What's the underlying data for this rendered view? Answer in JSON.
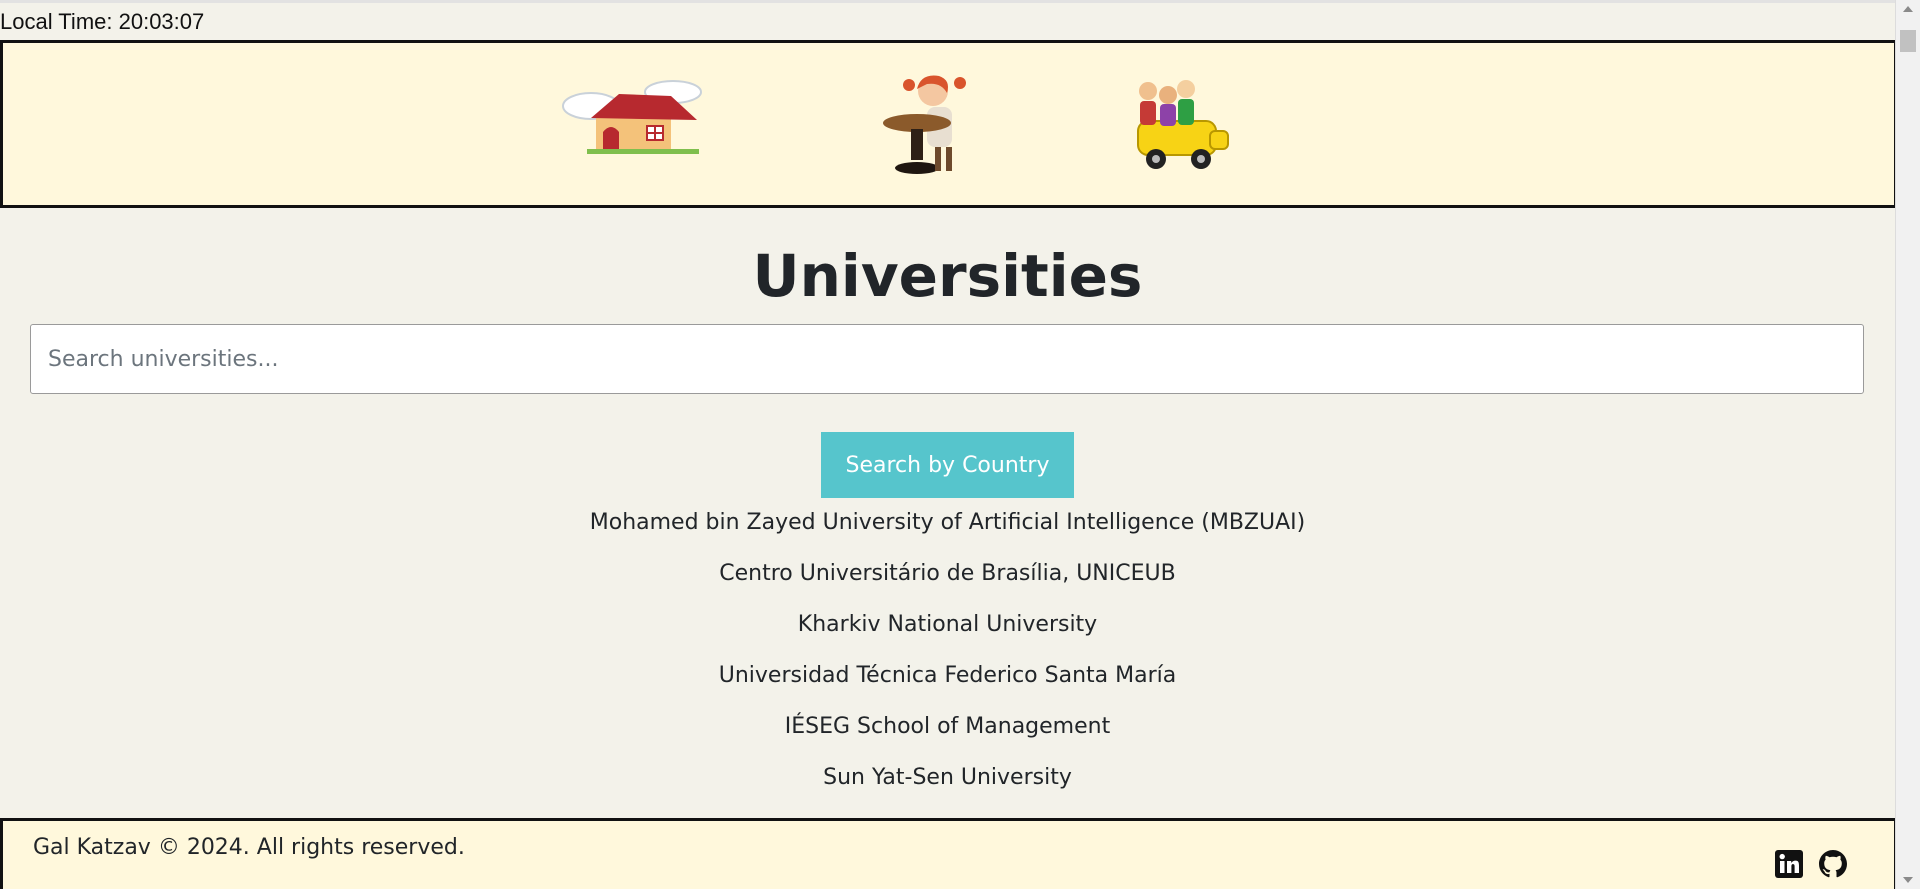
{
  "local_time": {
    "label": "Local Time: 20:03:07"
  },
  "header": {
    "images": [
      {
        "icon": "house-illustration"
      },
      {
        "icon": "girl-at-desk-illustration"
      },
      {
        "icon": "school-bus-kids-illustration"
      }
    ]
  },
  "main": {
    "title": "Universities",
    "search": {
      "placeholder": "Search universities...",
      "value": ""
    },
    "country_button_label": "Search by Country",
    "universities": [
      "Mohamed bin Zayed University of Artificial Intelligence (MBZUAI)",
      "Centro Universitário de Brasília, UNICEUB",
      "Kharkiv National University",
      "Universidad Técnica Federico Santa María",
      "IÉSEG School of Management",
      "Sun Yat-Sen University"
    ]
  },
  "footer": {
    "text": "Gal Katzav © 2024. All rights reserved.",
    "icons": [
      "linkedin-icon",
      "github-icon"
    ]
  },
  "colors": {
    "page_background": "#f3f2ea",
    "banner_background": "#fff8dc",
    "accent_button": "#56c5cc"
  }
}
